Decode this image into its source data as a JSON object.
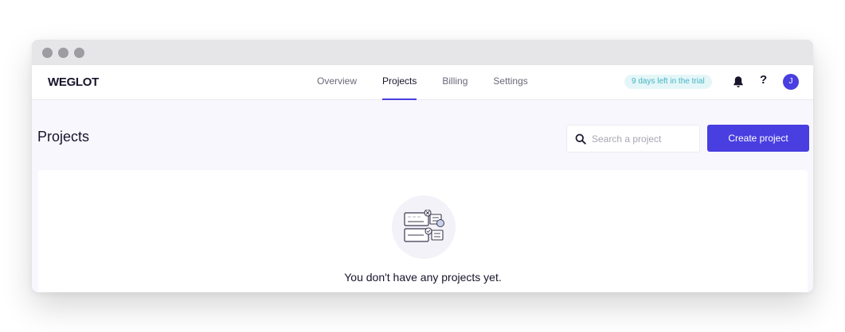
{
  "app": {
    "logo": "WEGLOT"
  },
  "nav": {
    "tabs": [
      {
        "label": "Overview",
        "active": false
      },
      {
        "label": "Projects",
        "active": true
      },
      {
        "label": "Billing",
        "active": false
      },
      {
        "label": "Settings",
        "active": false
      }
    ]
  },
  "header": {
    "trial_badge": "9 days left in the trial",
    "help_label": "?",
    "avatar_initial": "J",
    "icons": [
      "bell-icon",
      "help-icon"
    ]
  },
  "main": {
    "title": "Projects",
    "search": {
      "placeholder": "Search a project",
      "value": ""
    },
    "create_button_label": "Create project",
    "empty_state": {
      "message": "You don't have any projects yet."
    }
  },
  "colors": {
    "accent": "#493ee0",
    "trial_badge_bg": "#e4f6f8",
    "trial_badge_text": "#45b4c4",
    "page_bg": "#f8f7fd"
  }
}
